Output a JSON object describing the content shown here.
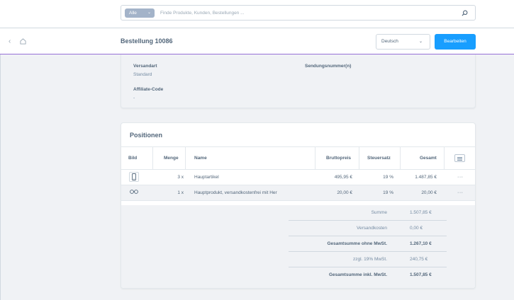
{
  "search": {
    "scope": "Alle",
    "placeholder": "Finde Produkte, Kunden, Bestellungen ..."
  },
  "header": {
    "title": "Bestellung 10086",
    "language": "Deutsch",
    "edit_label": "Bearbeiten"
  },
  "details": {
    "shipping_label": "Versandart",
    "shipping_value": "Standard",
    "tracking_label": "Sendungsnummer(n)",
    "affiliate_label": "Affiliate-Code",
    "affiliate_value": "-"
  },
  "positions": {
    "title": "Positionen",
    "columns": [
      "Bild",
      "Menge",
      "Name",
      "Bruttopreis",
      "Steuersatz",
      "Gesamt"
    ],
    "rows": [
      {
        "quantity": "3 x",
        "name": "Hauptartikel",
        "price": "495,95 €",
        "tax": "19 %",
        "total": "1.487,85 €",
        "icon": "phone-icon"
      },
      {
        "quantity": "1 x",
        "name": "Hauptprodukt, versandkostenfrei mit Her",
        "price": "20,00 €",
        "tax": "19 %",
        "total": "20,00 €",
        "icon": "glasses-icon"
      }
    ],
    "actions_label": "···"
  },
  "summary": [
    {
      "label": "Summe",
      "value": "1.507,85 €",
      "bold": false
    },
    {
      "label": "Versandkosten",
      "value": "0,00 €",
      "bold": false
    },
    {
      "label": "Gesamtsumme ohne MwSt.",
      "value": "1.267,10 €",
      "bold": true
    },
    {
      "label": "zzgl. 19% MwSt.",
      "value": "240,75 €",
      "bold": false
    },
    {
      "label": "Gesamtsumme inkl. MwSt.",
      "value": "1.507,85 €",
      "bold": true
    }
  ],
  "colors": {
    "primary": "#189eff",
    "accent_line": "#9670d6",
    "scope_badge": "#a3b3c9",
    "background": "#f0f2f5"
  }
}
